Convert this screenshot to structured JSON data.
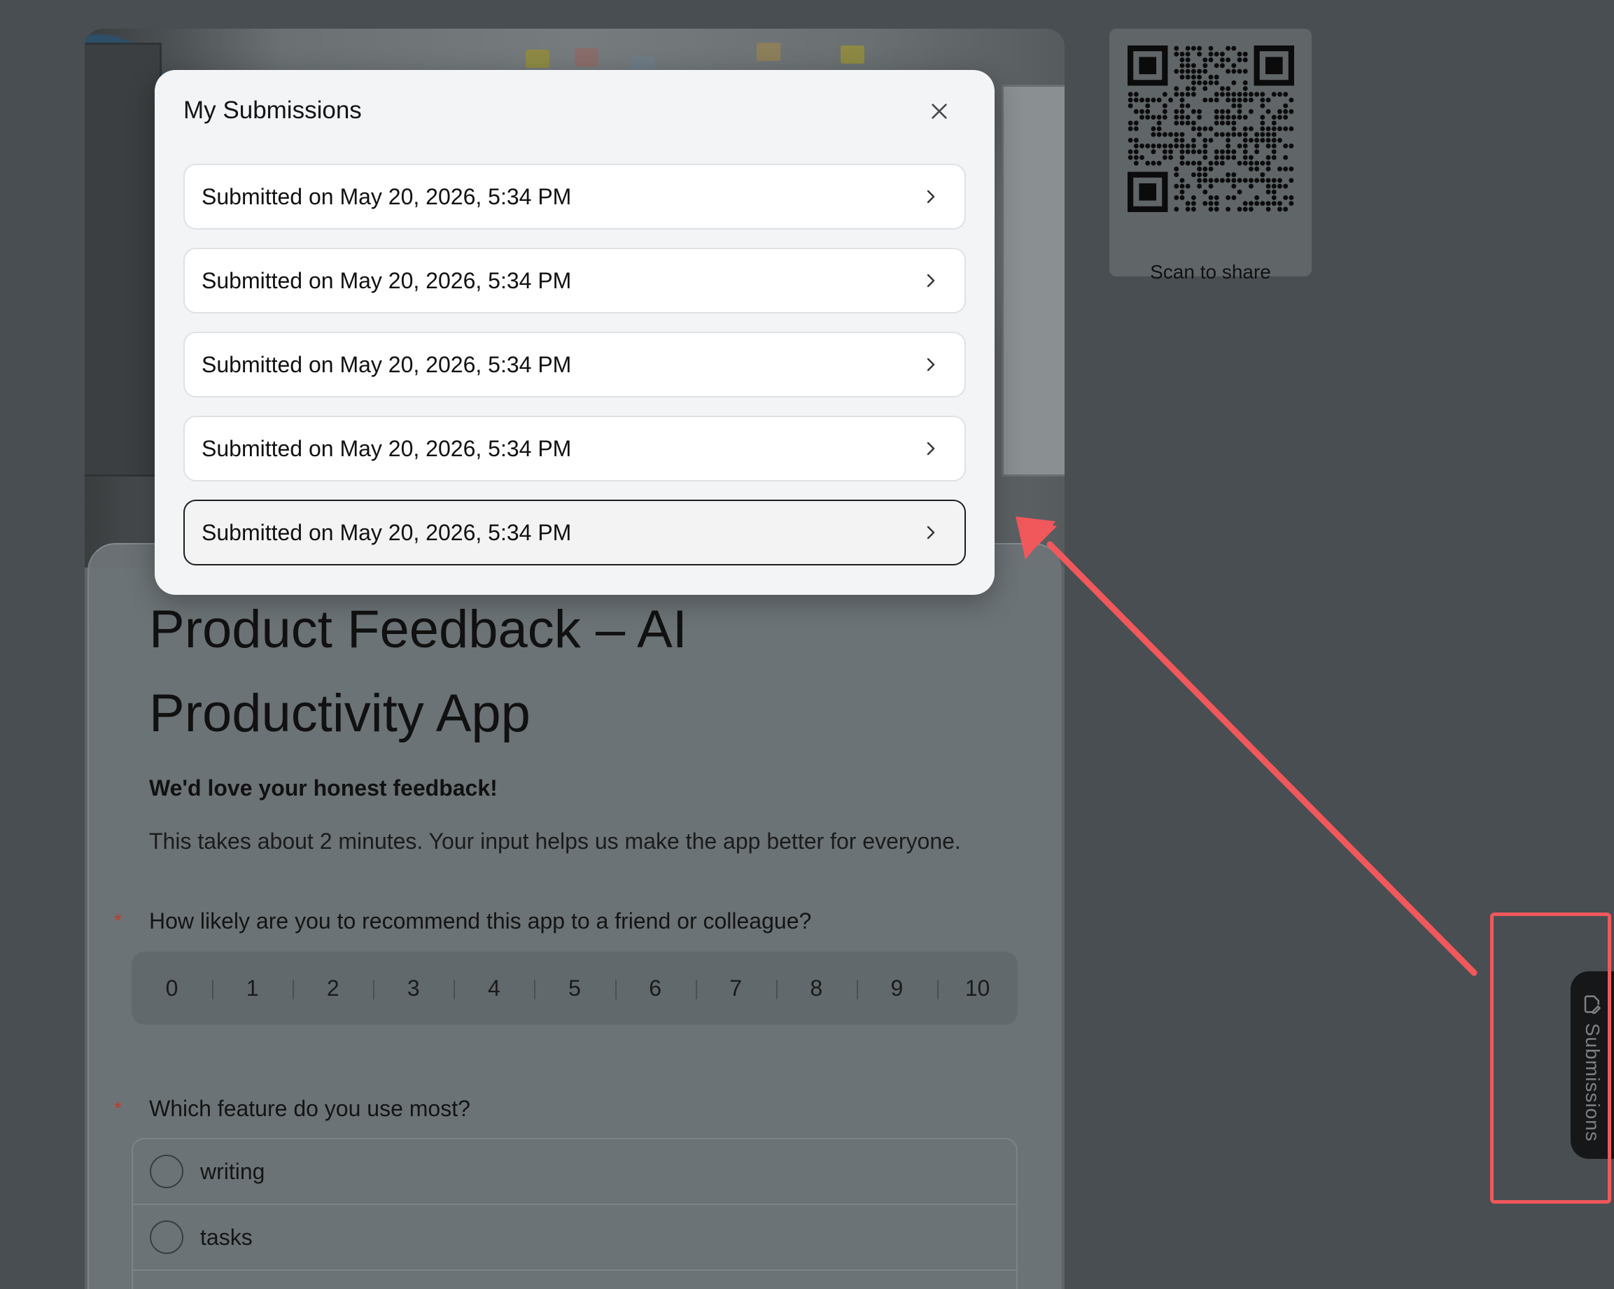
{
  "form": {
    "title": "Product Feedback – AI Productivity App",
    "subtitle": "We'd love your honest feedback!",
    "description": "This takes about 2 minutes. Your input helps us make the app better for everyone.",
    "required_marker": "*",
    "questions": [
      {
        "label": "How likely are you to recommend this app to a friend or colleague?",
        "scale": [
          "0",
          "1",
          "2",
          "3",
          "4",
          "5",
          "6",
          "7",
          "8",
          "9",
          "10"
        ]
      },
      {
        "label": "Which feature do you use most?",
        "options": [
          "writing",
          "tasks"
        ]
      }
    ]
  },
  "qr_card": {
    "caption": "Scan to share"
  },
  "side_tab": {
    "label": "Submissions",
    "icon": "document-edit-icon"
  },
  "modal": {
    "title": "My Submissions",
    "close_icon": "close-icon",
    "submissions": [
      {
        "label": "Submitted on May 20, 2026, 5:34 PM"
      },
      {
        "label": "Submitted on May 20, 2026, 5:34 PM"
      },
      {
        "label": "Submitted on May 20, 2026, 5:34 PM"
      },
      {
        "label": "Submitted on May 20, 2026, 5:34 PM"
      },
      {
        "label": "Submitted on May 20, 2026, 5:34 PM"
      }
    ],
    "active_index": 4
  },
  "colors": {
    "annotation": "#f0585b",
    "tab_bg": "#151718",
    "modal_bg": "#f3f4f6"
  }
}
